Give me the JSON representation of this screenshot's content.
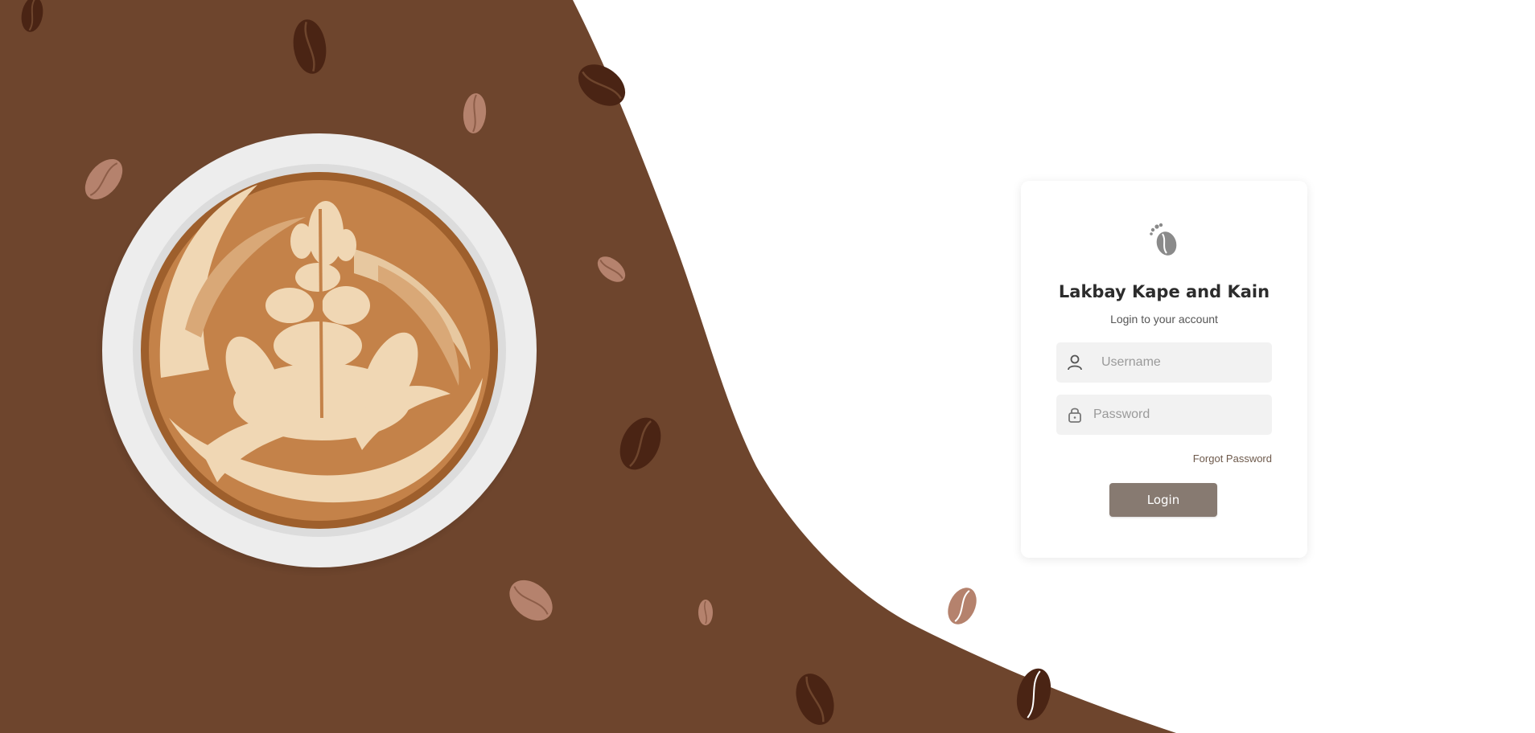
{
  "brand": {
    "title": "Lakbay Kape and Kain",
    "subtitle": "Login to your account",
    "logo_icon": "coffee-bean-footprint-logo"
  },
  "form": {
    "username": {
      "placeholder": "Username",
      "value": "",
      "icon": "user-icon"
    },
    "password": {
      "placeholder": "Password",
      "value": "",
      "icon": "lock-icon"
    },
    "forgot_label": "Forgot Password",
    "login_label": "Login"
  },
  "colors": {
    "background_brown": "#6e452d",
    "bean_dark": "#4a2414",
    "bean_light": "#b5826d",
    "button": "#877a71",
    "card": "#ffffff"
  }
}
